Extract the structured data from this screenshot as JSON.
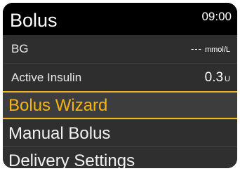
{
  "header": {
    "title": "Bolus",
    "time": "09:00"
  },
  "info": {
    "bg": {
      "label": "BG",
      "value": "---",
      "unit": "mmol/L"
    },
    "active_insulin": {
      "label": "Active Insulin",
      "value": "0.3",
      "unit": "U"
    }
  },
  "menu": {
    "selected_index": 0,
    "items": [
      {
        "label": "Bolus Wizard"
      },
      {
        "label": "Manual Bolus"
      },
      {
        "label": "Delivery Settings"
      }
    ]
  },
  "colors": {
    "accent": "#f2b91c",
    "header_bg": "#000000",
    "screen_bg": "#2b2b2b"
  }
}
